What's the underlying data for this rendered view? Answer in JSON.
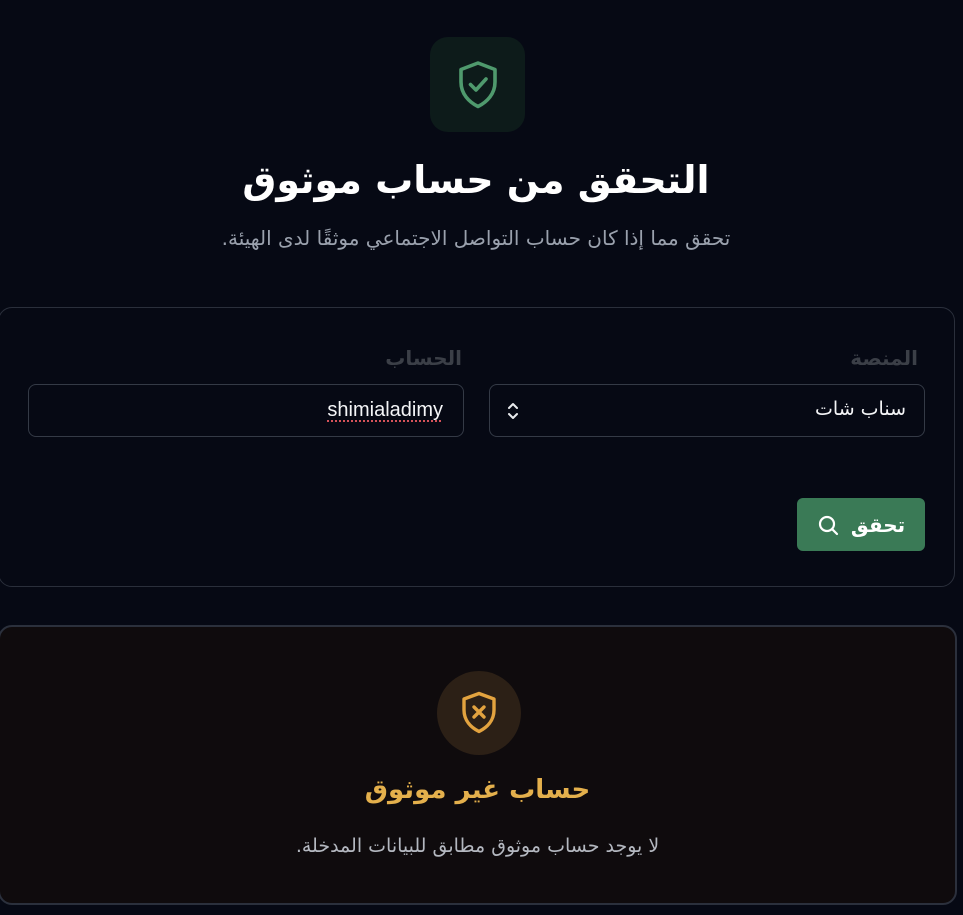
{
  "header": {
    "icon": "shield-check-icon",
    "title": "التحقق من حساب موثوق",
    "subtitle": "تحقق مما إذا كان حساب التواصل الاجتماعي موثقًا لدى الهيئة."
  },
  "form": {
    "platform_label": "المنصة",
    "platform_value": "سناب شات",
    "account_label": "الحساب",
    "account_value": "shimialadimy",
    "verify_label": "تحقق",
    "verify_icon": "search-icon"
  },
  "result": {
    "icon": "shield-x-icon",
    "title": "حساب غير موثوق",
    "message": "لا يوجد حساب موثوق مطابق للبيانات المدخلة."
  },
  "colors": {
    "background": "#060914",
    "accent_green": "#3a7a56",
    "warning": "#e4b04c"
  }
}
